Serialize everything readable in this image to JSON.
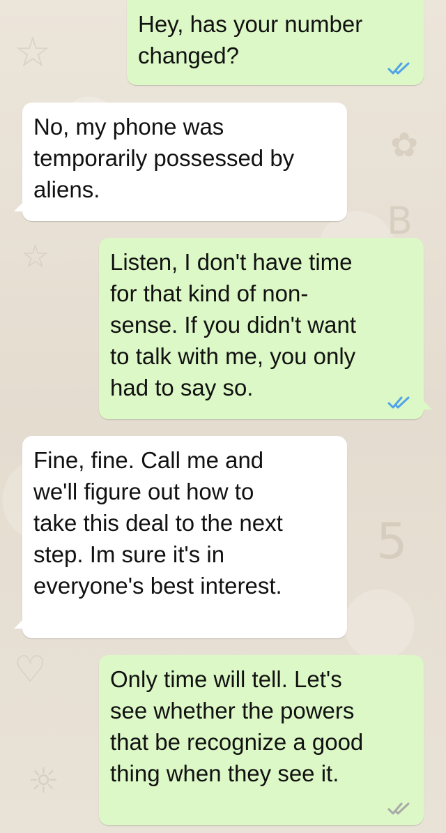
{
  "messages": [
    {
      "direction": "outgoing",
      "text": "Hey, has your number\nchanged?",
      "status": "read",
      "tick_icon": "double-check-icon",
      "tick_color": "#4fa3e8"
    },
    {
      "direction": "incoming",
      "text": "No, my phone was\ntemporarily possessed by\naliens."
    },
    {
      "direction": "outgoing",
      "text": "Listen, I don't have time\nfor that kind of non-\nsense. If you didn't want\nto talk with me, you only\nhad to say so.",
      "status": "read",
      "tick_icon": "double-check-icon",
      "tick_color": "#4fa3e8"
    },
    {
      "direction": "incoming",
      "text": "Fine, fine. Call me and\nwe'll figure out how to\ntake this deal to the next\nstep. Im sure it's in\neveryone's best interest."
    },
    {
      "direction": "outgoing",
      "text": "Only time will tell. Let's\nsee whether the powers\nthat be recognize a good\nthing when they see it.",
      "status": "delivered",
      "tick_icon": "double-check-icon",
      "tick_color": "#a8a8a8"
    }
  ],
  "colors": {
    "outgoing_bubble": "#dcf8c6",
    "incoming_bubble": "#ffffff",
    "wallpaper": "#e7dfd4"
  }
}
